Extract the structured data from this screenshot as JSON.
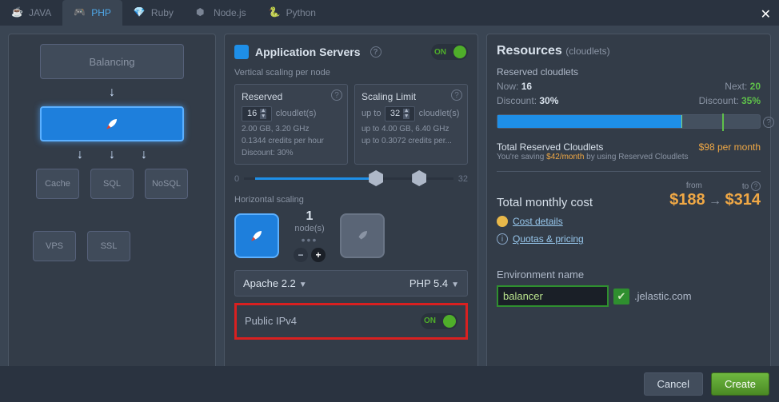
{
  "tabs": [
    {
      "label": "JAVA",
      "icon": "java-icon"
    },
    {
      "label": "PHP",
      "icon": "php-icon"
    },
    {
      "label": "Ruby",
      "icon": "ruby-icon"
    },
    {
      "label": "Node.js",
      "icon": "node-icon"
    },
    {
      "label": "Python",
      "icon": "python-icon"
    }
  ],
  "active_tab": 1,
  "topology": {
    "balancing_label": "Balancing",
    "small": [
      "Cache",
      "SQL",
      "NoSQL"
    ],
    "bottom": [
      "VPS",
      "SSL"
    ]
  },
  "app_servers": {
    "title": "Application Servers",
    "on_label": "ON",
    "vertical_label": "Vertical scaling per node",
    "reserved": {
      "title": "Reserved",
      "value": "16",
      "unit": "cloudlet(s)",
      "line1": "2.00 GB, 3.20 GHz",
      "line2": "0.1344 credits per hour",
      "discount": "Discount: 30%"
    },
    "limit": {
      "title": "Scaling Limit",
      "prefix": "up to",
      "value": "32",
      "unit": "cloudlet(s)",
      "line1": "up to 4.00 GB, 6.40 GHz",
      "line2": "up to 0.3072 credits per..."
    },
    "slider": {
      "min": "0",
      "max": "32"
    },
    "horizontal_label": "Horizontal scaling",
    "nodes": {
      "count": "1",
      "label": "node(s)"
    },
    "server_select": "Apache 2.2",
    "lang_select": "PHP 5.4",
    "ipv4_label": "Public IPv4",
    "ipv4_on": "ON"
  },
  "resources": {
    "title": "Resources",
    "unit": "(cloudlets)",
    "reserved_label": "Reserved cloudlets",
    "now_k": "Now:",
    "now_v": "16",
    "next_k": "Next:",
    "next_v": "20",
    "disc_k": "Discount:",
    "disc_v": "30%",
    "disc2_k": "Discount:",
    "disc2_v": "35%",
    "total_reserved": "Total Reserved Cloudlets",
    "total_reserved_v": "$98 per month",
    "saving_pre": "You're saving ",
    "saving_amt": "$42/month",
    "saving_post": " by using Reserved Cloudlets",
    "from_label": "from",
    "to_label": "to",
    "total_label": "Total monthly cost",
    "price_from": "$188",
    "price_to": "$314",
    "cost_details": "Cost details",
    "quotas": "Quotas & pricing",
    "env_label": "Environment name",
    "env_value": "balancer",
    "env_domain": ".jelastic.com"
  },
  "buttons": {
    "cancel": "Cancel",
    "create": "Create"
  }
}
